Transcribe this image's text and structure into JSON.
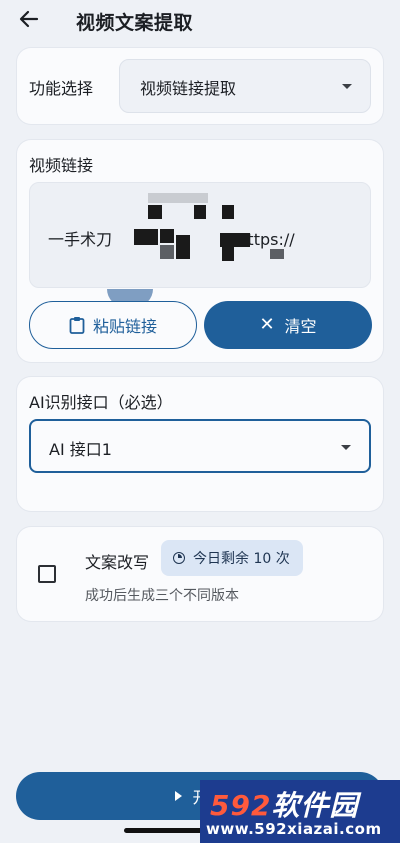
{
  "header": {
    "title": "视频文案提取",
    "back_icon": "arrow-left-icon"
  },
  "function_select": {
    "label": "功能选择",
    "value": "视频链接提取"
  },
  "video_link": {
    "label": "视频链接",
    "text": "一手术刀\n.. https://\nv.douyin\nQ/\nK@j.Cu",
    "paste_label": "粘贴链接",
    "paste_icon": "clipboard-icon",
    "clear_label": "清空",
    "clear_icon": "close-icon"
  },
  "ai_interface": {
    "label": "AI识别接口（必选）",
    "value": "AI 接口1"
  },
  "rewrite": {
    "title": "文案改写",
    "badge": "今日剩余 10 次",
    "badge_icon": "clock-icon",
    "description": "成功后生成三个不同版本",
    "checked": false
  },
  "start_button": {
    "label": "开始",
    "icon": "play-icon"
  },
  "watermark": {
    "brand_number": "592",
    "brand_text": "软件园",
    "url": "www.592xiazai.com"
  },
  "colors": {
    "primary": "#1f5f9a",
    "background": "#eef1f6",
    "card": "#fafbfd"
  }
}
